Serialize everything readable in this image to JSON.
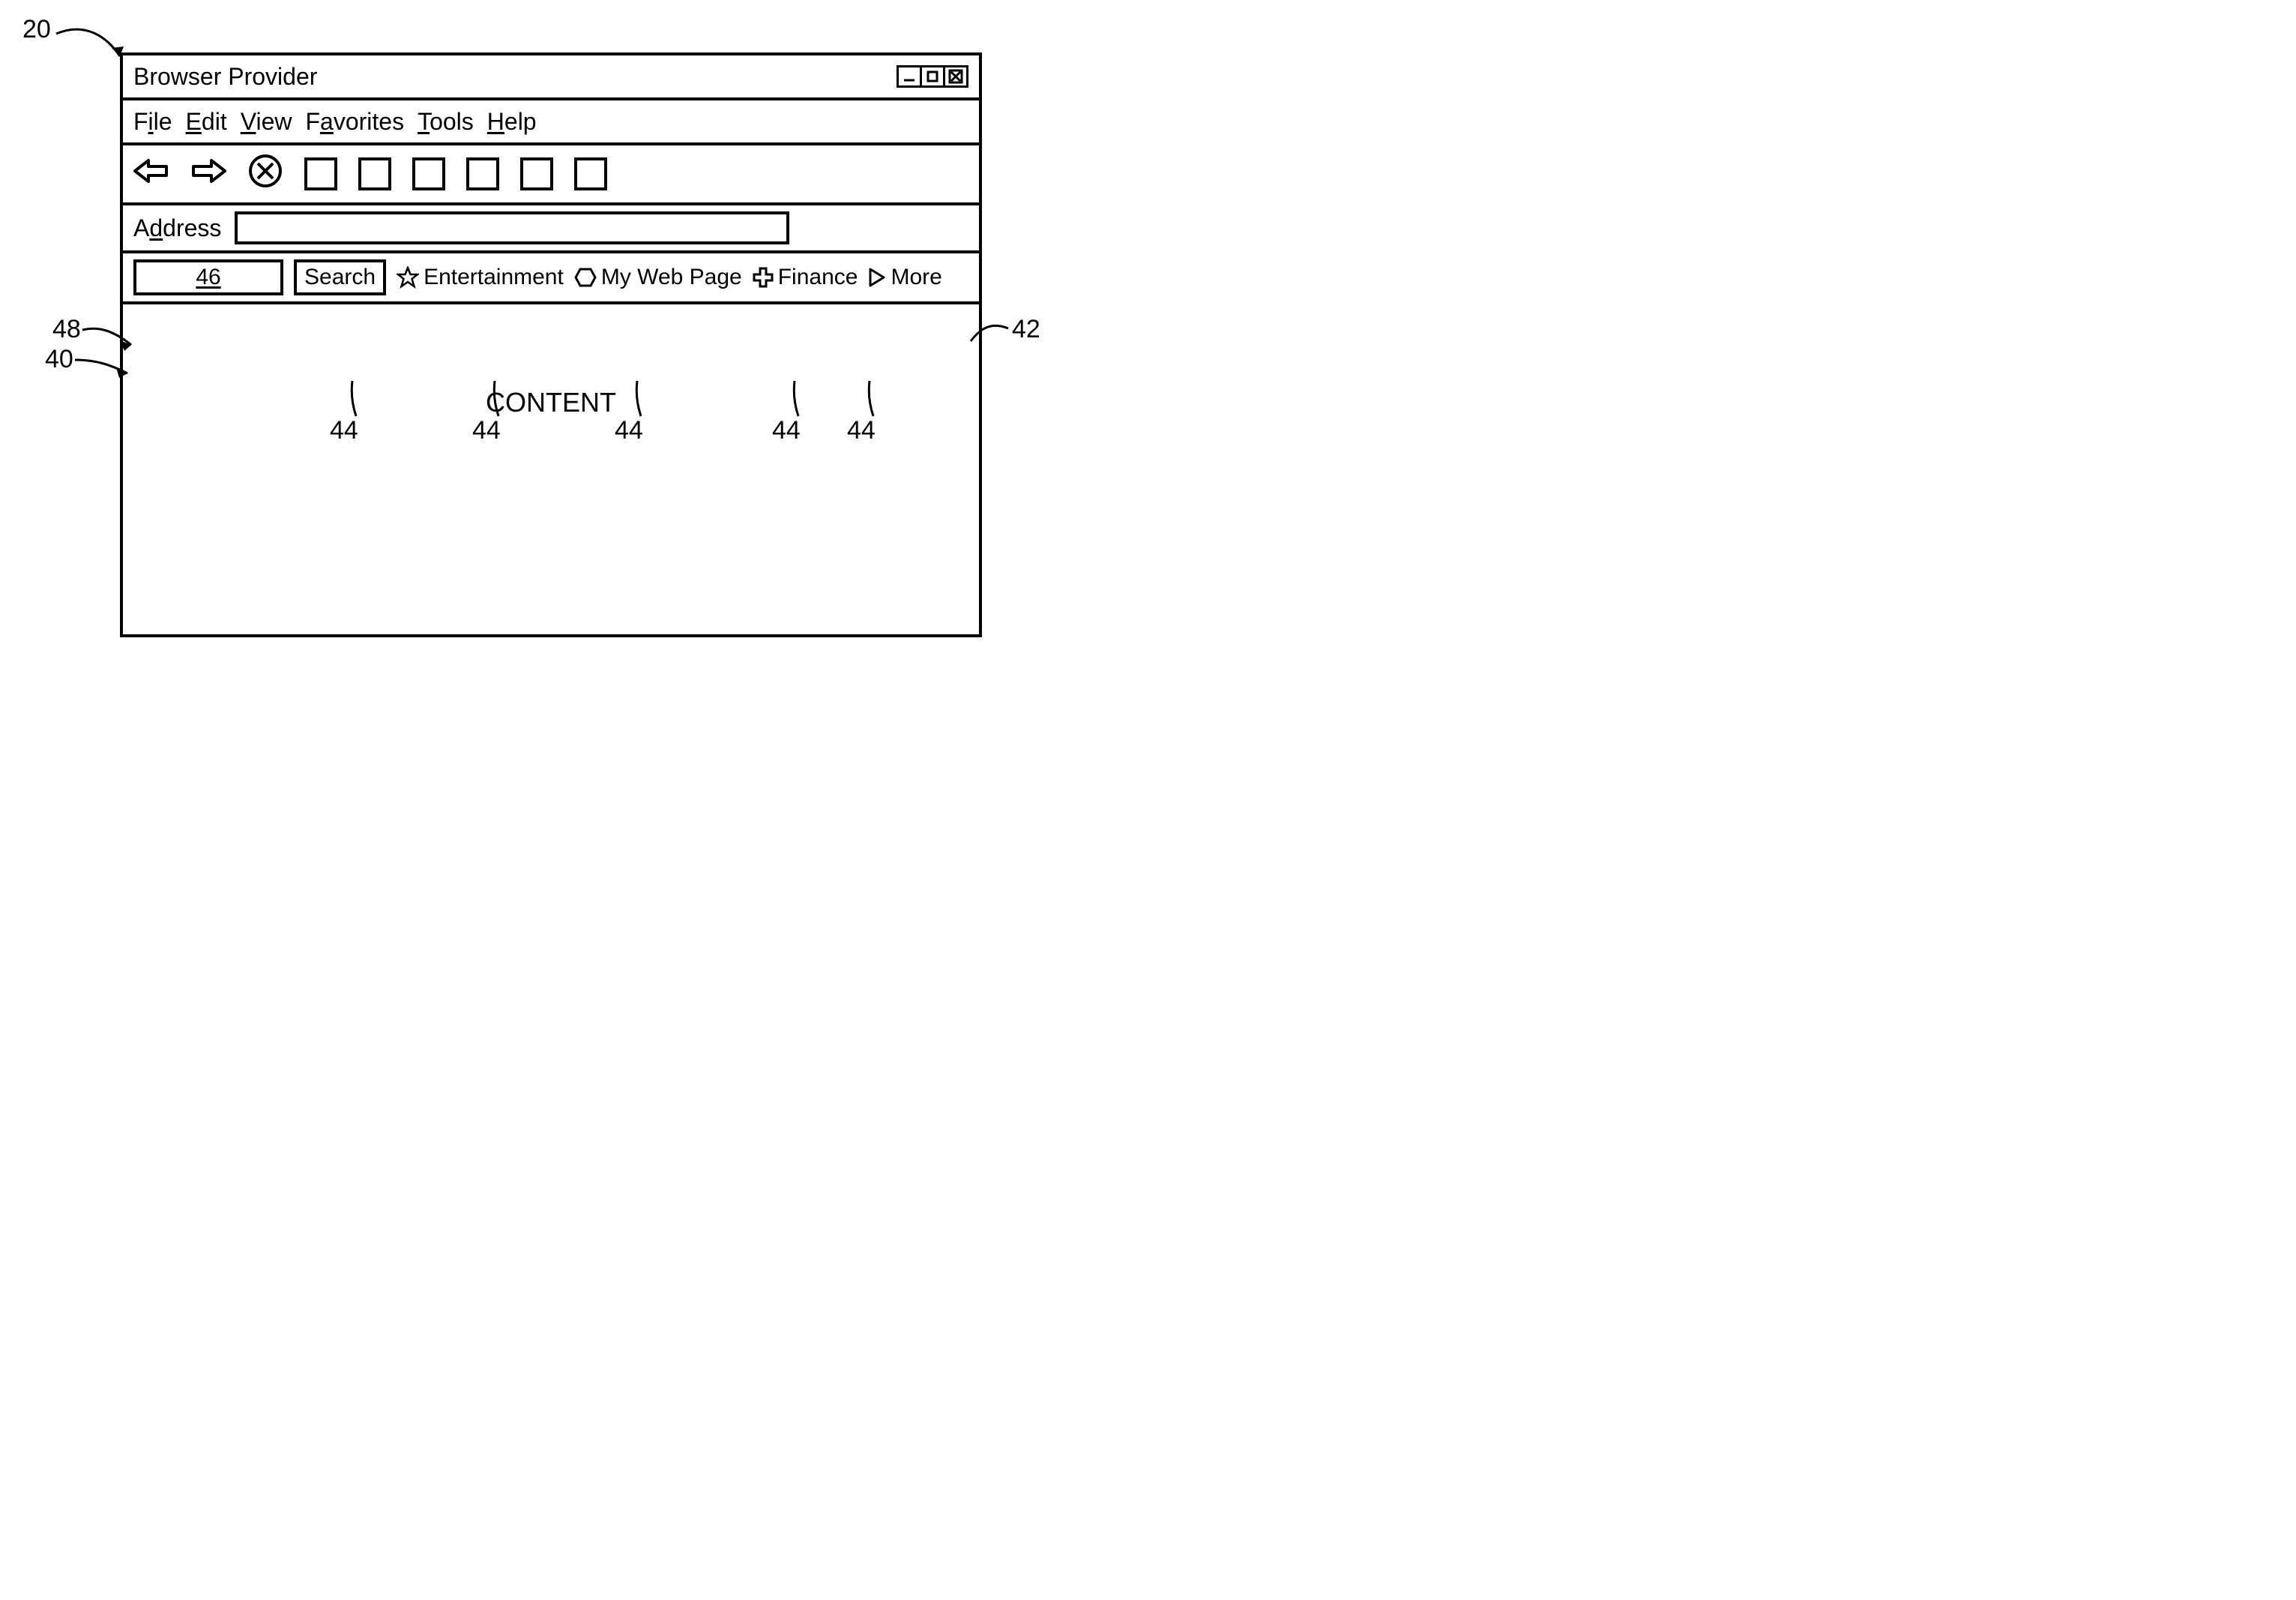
{
  "window": {
    "title": "Browser Provider"
  },
  "menubar": {
    "file": {
      "pre": "F",
      "u": "i",
      "post": "le"
    },
    "edit": {
      "pre": "",
      "u": "E",
      "post": "dit"
    },
    "view": {
      "pre": "",
      "u": "V",
      "post": "iew"
    },
    "favorites": {
      "pre": "F",
      "u": "a",
      "post": "vorites"
    },
    "tools": {
      "pre": "",
      "u": "T",
      "post": "ools"
    },
    "help": {
      "pre": "",
      "u": "H",
      "post": "elp"
    }
  },
  "addressbar": {
    "label": {
      "pre": "A",
      "u": "d",
      "post": "dress"
    }
  },
  "customBar": {
    "input_text": "46",
    "search_label": "Search",
    "links": {
      "entertainment": "Entertainment",
      "myweb": "My Web Page",
      "finance": "Finance",
      "more": "More"
    }
  },
  "content": {
    "placeholder": "CONTENT"
  },
  "callouts": {
    "n20": "20",
    "n48": "48",
    "n40": "40",
    "n42": "42",
    "n44": "44"
  }
}
